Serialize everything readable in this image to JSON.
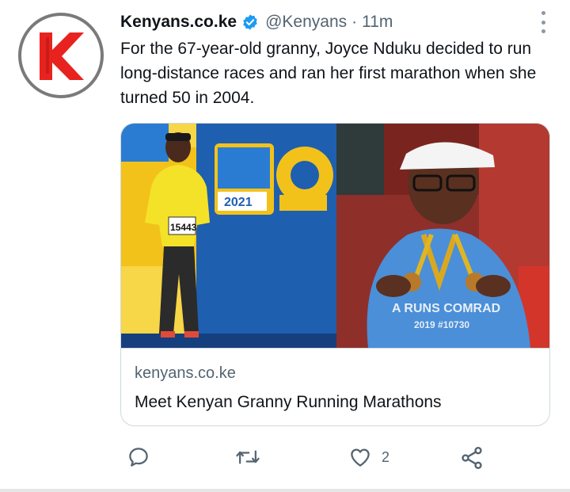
{
  "account": {
    "name": "Kenyans.co.ke",
    "handle": "@Kenyans",
    "separator": "·",
    "time": "11m",
    "avatar_letter": "K",
    "verified_color": "#1d9bf0"
  },
  "tweet": {
    "text": "For the 67-year-old granny, Joyce Nduku decided to run long-distance races and ran her first marathon when she turned 50 in 2004."
  },
  "card": {
    "domain": "kenyans.co.ke",
    "title": "Meet Kenyan Granny Running Marathons",
    "left_photo": {
      "bib": "15443",
      "banner_year": "2021"
    },
    "right_photo": {
      "shirt_line1": "A RUNS COMRAD",
      "shirt_line2": "2019 #10730"
    }
  },
  "actions": {
    "reply_icon": "reply-icon",
    "retweet_icon": "retweet-icon",
    "like_icon": "like-icon",
    "like_count": "2",
    "share_icon": "share-icon"
  },
  "colors": {
    "accent": "#1d9bf0",
    "muted": "#536471",
    "brand_red": "#e8231f"
  }
}
